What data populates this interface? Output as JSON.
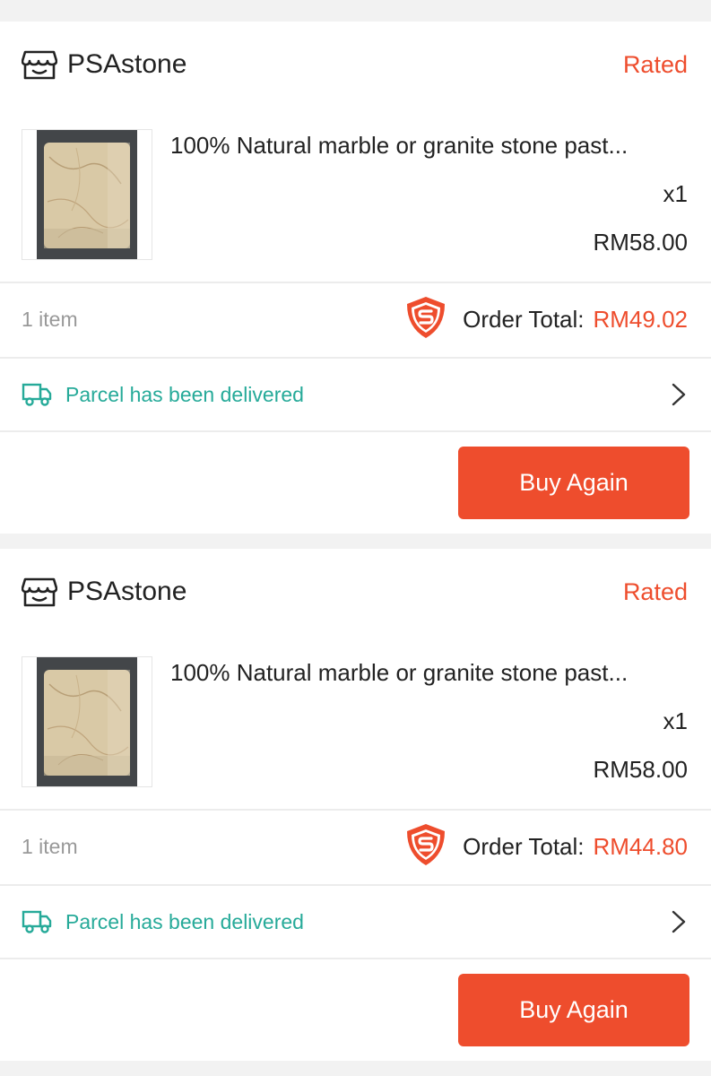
{
  "colors": {
    "accent": "#ee4d2d",
    "delivered": "#26aa99",
    "muted": "#999999",
    "background": "#f2f2f2"
  },
  "orders": [
    {
      "shop_name": "PSAstone",
      "shop_icon": "store-icon",
      "status": "Rated",
      "product_name": "100% Natural marble or granite stone past...",
      "quantity": "x1",
      "price": "RM58.00",
      "item_count": "1 item",
      "total_label": "Order Total:",
      "total_value": "RM49.02",
      "delivery_icon": "truck-icon",
      "delivery_status": "Parcel has been delivered",
      "buy_again_label": "Buy Again"
    },
    {
      "shop_name": "PSAstone",
      "shop_icon": "store-icon",
      "status": "Rated",
      "product_name": "100% Natural marble or granite stone past...",
      "quantity": "x1",
      "price": "RM58.00",
      "item_count": "1 item",
      "total_label": "Order Total:",
      "total_value": "RM44.80",
      "delivery_icon": "truck-icon",
      "delivery_status": "Parcel has been delivered",
      "buy_again_label": "Buy Again"
    }
  ]
}
